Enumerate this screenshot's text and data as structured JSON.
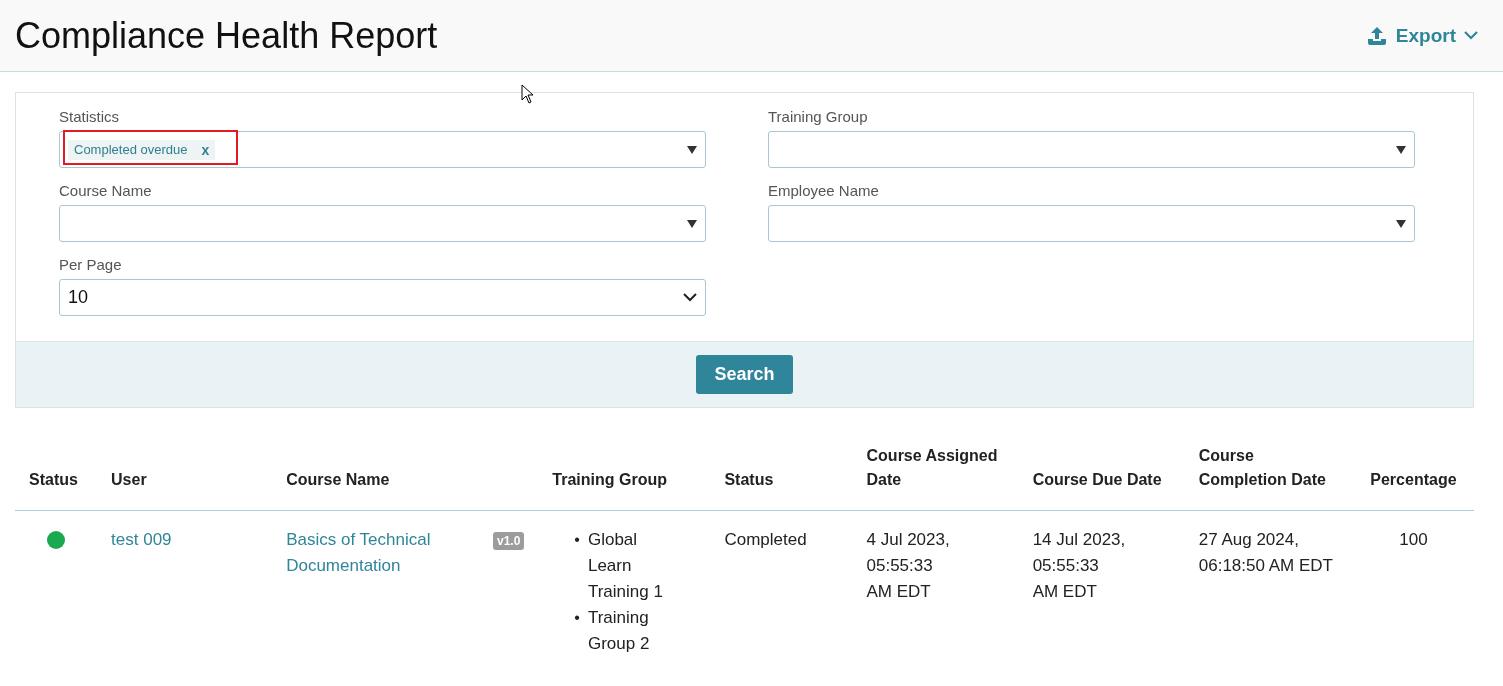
{
  "header": {
    "title": "Compliance Health Report",
    "export_label": "Export"
  },
  "filters": [
    {
      "label": "Statistics",
      "kind": "multi",
      "tags": [
        {
          "label": "Completed overdue",
          "remove": "x",
          "highlighted": true
        }
      ]
    },
    {
      "label": "Training Group",
      "kind": "multi"
    },
    {
      "label": "Course Name",
      "kind": "multi"
    },
    {
      "label": "Employee Name",
      "kind": "multi"
    },
    {
      "label": "Per Page",
      "kind": "select",
      "value": "10"
    }
  ],
  "search_button": "Search",
  "table": {
    "columns": [
      "Status",
      "User",
      "Course Name",
      "Training Group",
      "Status",
      "Course Assigned Date",
      "Course Due Date",
      "Course Completion Date",
      "Percentage"
    ],
    "rows": [
      {
        "color": "#1aa94f",
        "user": "test 009",
        "course": "Basics of Technical Documentation",
        "version": "v1.0",
        "groups": [
          {
            "bullet": "•",
            "label": "Global Learn Training 1"
          },
          {
            "bullet": "•",
            "label": "Training Group 2"
          }
        ],
        "status": "Completed",
        "assigned": "4 Jul 2023, 05:55:33 AM EDT",
        "due": "14 Jul 2023, 05:55:33 AM EDT",
        "completion": "27 Aug 2024, 06:18:50 AM EDT",
        "percentage": "100"
      }
    ]
  }
}
